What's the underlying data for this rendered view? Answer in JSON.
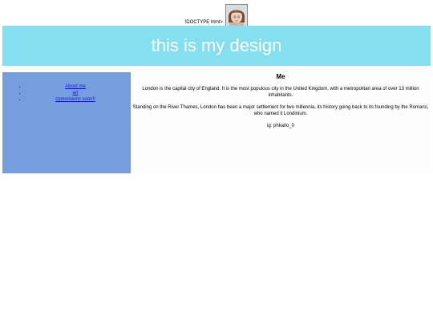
{
  "stray_doctype_text": "!DOCTYPE html>",
  "avatar": {
    "icon": "cartoon-face-avatar"
  },
  "banner": {
    "title": "this is my design"
  },
  "sidebar": {
    "links": [
      {
        "label": "About me"
      },
      {
        "label": "art"
      },
      {
        "label": "commisions soon!!"
      }
    ]
  },
  "content": {
    "heading": "Me",
    "paragraphs": [
      "London is the capital city of England. It is the most populous city in the United Kingdom, with a metropolitan area of over 13 million inhabitants.",
      "Standing on the River Thames, London has been a major settlement for two millennia, its history going back to its founding by the Romans, who named it Londinium.",
      "ig: phkaito_0"
    ]
  },
  "colors": {
    "banner": "#84e0ee",
    "sidebar": "#759ede",
    "link": "#1a1acc",
    "banner_text": "#ffffff"
  }
}
